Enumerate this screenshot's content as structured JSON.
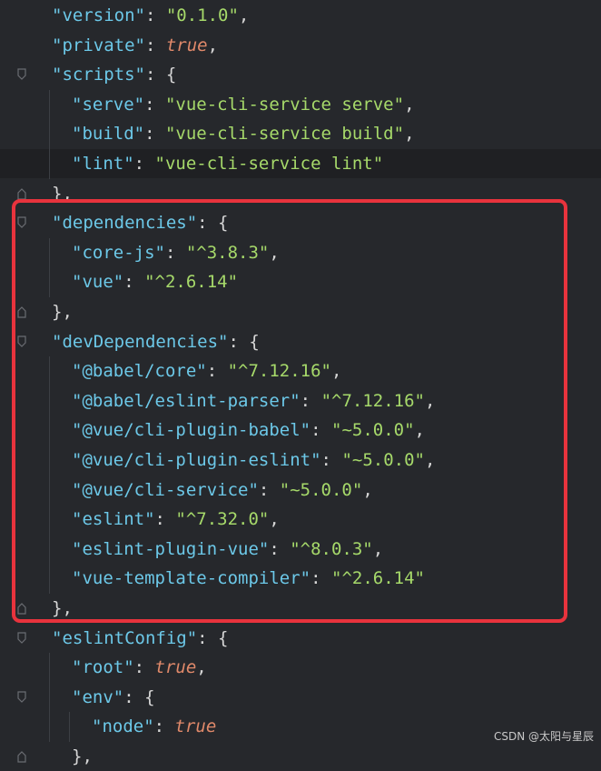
{
  "lines": [
    {
      "indent": 1,
      "tokens": [
        {
          "t": "k",
          "v": "\"version\""
        },
        {
          "t": "p",
          "v": ": "
        },
        {
          "t": "s",
          "v": "\"0.1.0\""
        },
        {
          "t": "p",
          "v": ","
        }
      ]
    },
    {
      "indent": 1,
      "tokens": [
        {
          "t": "k",
          "v": "\"private\""
        },
        {
          "t": "p",
          "v": ": "
        },
        {
          "t": "b",
          "v": "true"
        },
        {
          "t": "p",
          "v": ","
        }
      ]
    },
    {
      "indent": 1,
      "fold": "open",
      "tokens": [
        {
          "t": "k",
          "v": "\"scripts\""
        },
        {
          "t": "p",
          "v": ": {"
        }
      ]
    },
    {
      "indent": 2,
      "tokens": [
        {
          "t": "k",
          "v": "\"serve\""
        },
        {
          "t": "p",
          "v": ": "
        },
        {
          "t": "s",
          "v": "\"vue-cli-service serve\""
        },
        {
          "t": "p",
          "v": ","
        }
      ]
    },
    {
      "indent": 2,
      "tokens": [
        {
          "t": "k",
          "v": "\"build\""
        },
        {
          "t": "p",
          "v": ": "
        },
        {
          "t": "s",
          "v": "\"vue-cli-service build\""
        },
        {
          "t": "p",
          "v": ","
        }
      ]
    },
    {
      "indent": 2,
      "current": true,
      "tokens": [
        {
          "t": "k",
          "v": "\"lint\""
        },
        {
          "t": "p",
          "v": ": "
        },
        {
          "t": "s",
          "v": "\"vue-cli-service lint\""
        }
      ]
    },
    {
      "indent": 1,
      "fold": "close",
      "tokens": [
        {
          "t": "p",
          "v": "},"
        }
      ]
    },
    {
      "indent": 1,
      "fold": "open",
      "tokens": [
        {
          "t": "k",
          "v": "\"dependencies\""
        },
        {
          "t": "p",
          "v": ": {"
        }
      ]
    },
    {
      "indent": 2,
      "tokens": [
        {
          "t": "k",
          "v": "\"core-js\""
        },
        {
          "t": "p",
          "v": ": "
        },
        {
          "t": "s",
          "v": "\"^3.8.3\""
        },
        {
          "t": "p",
          "v": ","
        }
      ]
    },
    {
      "indent": 2,
      "tokens": [
        {
          "t": "k",
          "v": "\"vue\""
        },
        {
          "t": "p",
          "v": ": "
        },
        {
          "t": "s",
          "v": "\"^2.6.14\""
        }
      ]
    },
    {
      "indent": 1,
      "fold": "close",
      "tokens": [
        {
          "t": "p",
          "v": "},"
        }
      ]
    },
    {
      "indent": 1,
      "fold": "open",
      "tokens": [
        {
          "t": "k",
          "v": "\"devDependencies\""
        },
        {
          "t": "p",
          "v": ": {"
        }
      ]
    },
    {
      "indent": 2,
      "tokens": [
        {
          "t": "k",
          "v": "\"@babel/core\""
        },
        {
          "t": "p",
          "v": ": "
        },
        {
          "t": "s",
          "v": "\"^7.12.16\""
        },
        {
          "t": "p",
          "v": ","
        }
      ]
    },
    {
      "indent": 2,
      "tokens": [
        {
          "t": "k",
          "v": "\"@babel/eslint-parser\""
        },
        {
          "t": "p",
          "v": ": "
        },
        {
          "t": "s",
          "v": "\"^7.12.16\""
        },
        {
          "t": "p",
          "v": ","
        }
      ]
    },
    {
      "indent": 2,
      "tokens": [
        {
          "t": "k",
          "v": "\"@vue/cli-plugin-babel\""
        },
        {
          "t": "p",
          "v": ": "
        },
        {
          "t": "s",
          "v": "\"~5.0.0\""
        },
        {
          "t": "p",
          "v": ","
        }
      ]
    },
    {
      "indent": 2,
      "tokens": [
        {
          "t": "k",
          "v": "\"@vue/cli-plugin-eslint\""
        },
        {
          "t": "p",
          "v": ": "
        },
        {
          "t": "s",
          "v": "\"~5.0.0\""
        },
        {
          "t": "p",
          "v": ","
        }
      ]
    },
    {
      "indent": 2,
      "tokens": [
        {
          "t": "k",
          "v": "\"@vue/cli-service\""
        },
        {
          "t": "p",
          "v": ": "
        },
        {
          "t": "s",
          "v": "\"~5.0.0\""
        },
        {
          "t": "p",
          "v": ","
        }
      ]
    },
    {
      "indent": 2,
      "tokens": [
        {
          "t": "k",
          "v": "\"eslint\""
        },
        {
          "t": "p",
          "v": ": "
        },
        {
          "t": "s",
          "v": "\"^7.32.0\""
        },
        {
          "t": "p",
          "v": ","
        }
      ]
    },
    {
      "indent": 2,
      "tokens": [
        {
          "t": "k",
          "v": "\"eslint-plugin-vue\""
        },
        {
          "t": "p",
          "v": ": "
        },
        {
          "t": "s",
          "v": "\"^8.0.3\""
        },
        {
          "t": "p",
          "v": ","
        }
      ]
    },
    {
      "indent": 2,
      "tokens": [
        {
          "t": "k",
          "v": "\"vue-template-compiler\""
        },
        {
          "t": "p",
          "v": ": "
        },
        {
          "t": "s",
          "v": "\"^2.6.14\""
        }
      ]
    },
    {
      "indent": 1,
      "fold": "close",
      "tokens": [
        {
          "t": "p",
          "v": "},"
        }
      ]
    },
    {
      "indent": 1,
      "fold": "open",
      "tokens": [
        {
          "t": "k",
          "v": "\"eslintConfig\""
        },
        {
          "t": "p",
          "v": ": {"
        }
      ]
    },
    {
      "indent": 2,
      "tokens": [
        {
          "t": "k",
          "v": "\"root\""
        },
        {
          "t": "p",
          "v": ": "
        },
        {
          "t": "b",
          "v": "true"
        },
        {
          "t": "p",
          "v": ","
        }
      ]
    },
    {
      "indent": 2,
      "fold": "open",
      "tokens": [
        {
          "t": "k",
          "v": "\"env\""
        },
        {
          "t": "p",
          "v": ": {"
        }
      ]
    },
    {
      "indent": 3,
      "tokens": [
        {
          "t": "k",
          "v": "\"node\""
        },
        {
          "t": "p",
          "v": ": "
        },
        {
          "t": "b",
          "v": "true"
        }
      ]
    },
    {
      "indent": 2,
      "fold": "close",
      "tokens": [
        {
          "t": "p",
          "v": "},"
        }
      ]
    }
  ],
  "token_colors": {
    "k": "#6cc8e8",
    "s": "#a6d96a",
    "b": "#e0896a",
    "p": "#d6d6d6"
  },
  "highlight_color": "#e8333d",
  "watermark": "CSDN @太阳与星辰"
}
